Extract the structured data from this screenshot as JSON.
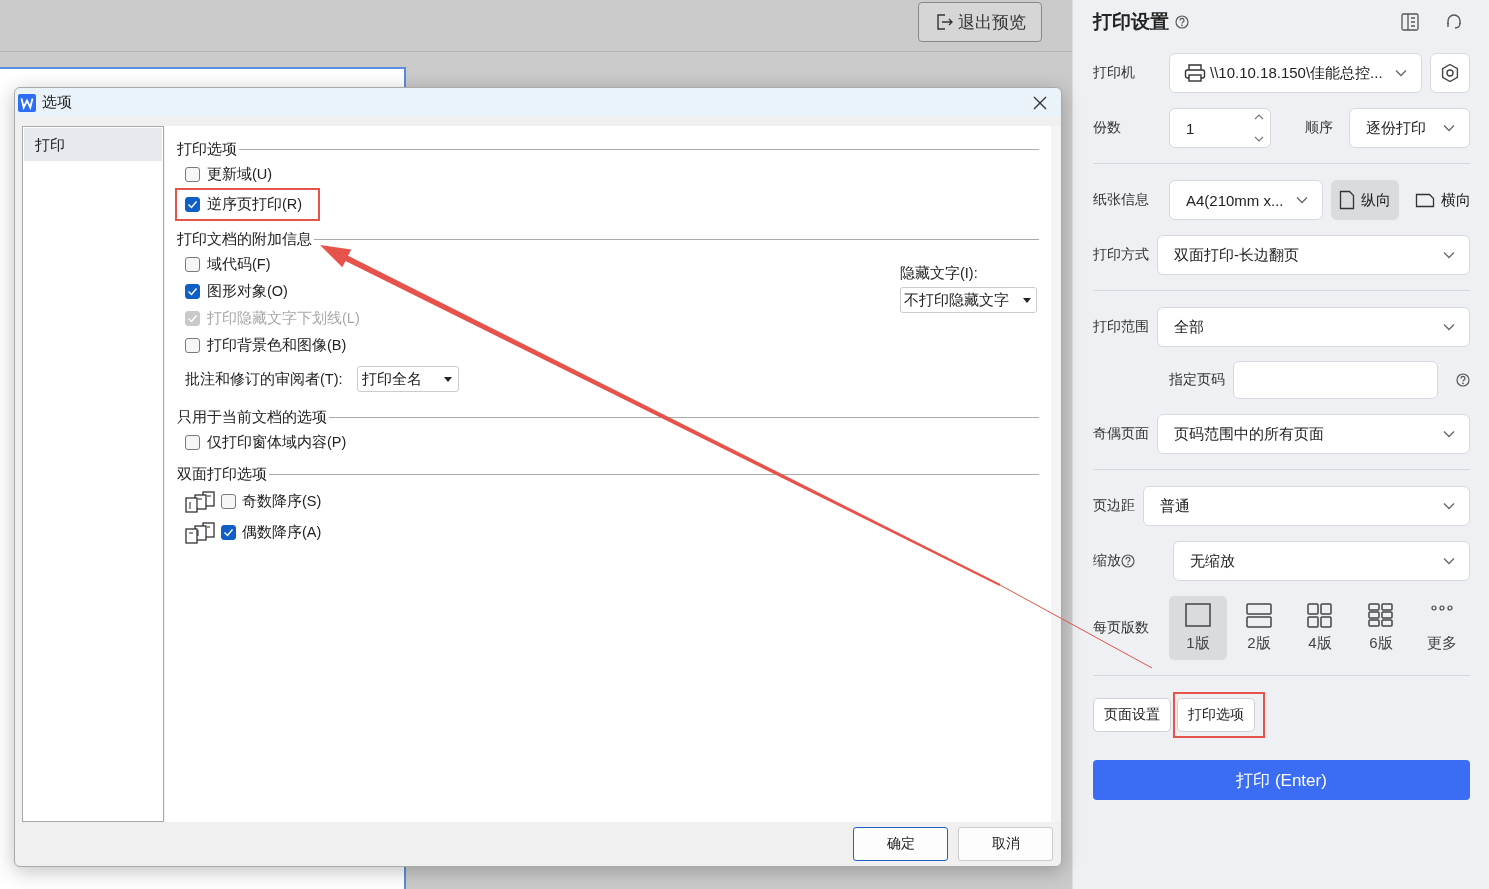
{
  "toolbar": {
    "exit_button": "退出预览"
  },
  "dialog": {
    "title": "选项",
    "close": true,
    "categories": [
      {
        "label": "打印",
        "selected": true
      }
    ],
    "sections": [
      {
        "title": "打印选项",
        "items": [
          {
            "kind": "checkbox",
            "label": "更新域(U)",
            "checked": false,
            "disabled": false,
            "annotated": false
          },
          {
            "kind": "checkbox",
            "label": "逆序页打印(R)",
            "checked": true,
            "disabled": false,
            "annotated": true
          }
        ]
      },
      {
        "title": "打印文档的附加信息",
        "side_field": {
          "label": "隐藏文字(I):",
          "value": "不打印隐藏文字"
        },
        "items": [
          {
            "kind": "checkbox",
            "label": "域代码(F)",
            "checked": false,
            "disabled": false,
            "annotated": false
          },
          {
            "kind": "checkbox",
            "label": "图形对象(O)",
            "checked": true,
            "disabled": false,
            "annotated": false
          },
          {
            "kind": "checkbox",
            "label": "打印隐藏文字下划线(L)",
            "checked": true,
            "disabled": true,
            "annotated": false
          },
          {
            "kind": "checkbox",
            "label": "打印背景色和图像(B)",
            "checked": false,
            "disabled": false,
            "annotated": false
          },
          {
            "kind": "select",
            "label": "批注和修订的审阅者(T):",
            "value": "打印全名"
          }
        ]
      },
      {
        "title": "只用于当前文档的选项",
        "items": [
          {
            "kind": "checkbox",
            "label": "仅打印窗体域内容(P)",
            "checked": false,
            "disabled": false,
            "annotated": false
          }
        ]
      },
      {
        "title": "双面打印选项",
        "items": [
          {
            "kind": "duplex_odd",
            "label": "奇数降序(S)",
            "checked": false
          },
          {
            "kind": "duplex_even",
            "label": "偶数降序(A)",
            "checked": true
          }
        ]
      }
    ],
    "buttons": [
      "确定",
      "取消"
    ]
  },
  "annotation_arrow": true,
  "print_settings": {
    "title": "打印设置",
    "help": true,
    "rows": [
      {
        "kind": "printer",
        "label": "打印机",
        "value": "\\\\10.10.18.150\\佳能总控..."
      },
      {
        "kind": "copies",
        "label": "份数",
        "value": "1",
        "order_label": "顺序",
        "order_value": "逐份打印"
      },
      {
        "kind": "divider"
      },
      {
        "kind": "paper",
        "label": "纸张信息",
        "value": "A4(210mm x...",
        "orientations": [
          {
            "label": "纵向",
            "selected": true
          },
          {
            "label": "横向",
            "selected": false
          }
        ]
      },
      {
        "kind": "select",
        "label": "打印方式",
        "value": "双面打印-长边翻页",
        "help": false
      },
      {
        "kind": "divider"
      },
      {
        "kind": "select",
        "label": "打印范围",
        "value": "全部",
        "help": false
      },
      {
        "kind": "input",
        "label": "指定页码",
        "help": true
      },
      {
        "kind": "select",
        "label": "奇偶页面",
        "value": "页码范围中的所有页面",
        "help": false
      },
      {
        "kind": "divider"
      },
      {
        "kind": "select",
        "label": "页边距",
        "value": "普通",
        "help": false
      },
      {
        "kind": "select",
        "label": "缩放",
        "value": "无缩放",
        "help": true
      },
      {
        "kind": "layout",
        "label": "每页版数",
        "options": [
          {
            "label": "1版",
            "selected": true
          },
          {
            "label": "2版",
            "selected": false
          },
          {
            "label": "4版",
            "selected": false
          },
          {
            "label": "6版",
            "selected": false
          },
          {
            "label": "更多",
            "selected": false
          }
        ]
      },
      {
        "kind": "divider"
      }
    ],
    "buttons": [
      {
        "label": "页面设置",
        "annotated": false
      },
      {
        "label": "打印选项",
        "annotated": true
      }
    ],
    "print_button": "打印 (Enter)"
  }
}
